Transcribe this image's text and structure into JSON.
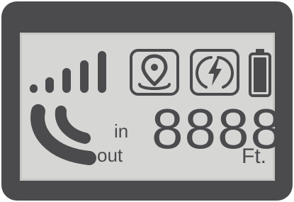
{
  "display": {
    "inlet_label": "in",
    "outlet_label": "out",
    "digits": "8888",
    "unit": "Ft."
  },
  "indicators": {
    "signal_bars": 5,
    "icons": [
      "signal-strength-icon",
      "location-pin-icon",
      "charging-bolt-icon",
      "battery-icon",
      "pipe-curve-icon"
    ]
  },
  "colors": {
    "bezel": "#4b4b4d",
    "screen": "#d6d6d4",
    "segment": "#4b4b4d"
  }
}
